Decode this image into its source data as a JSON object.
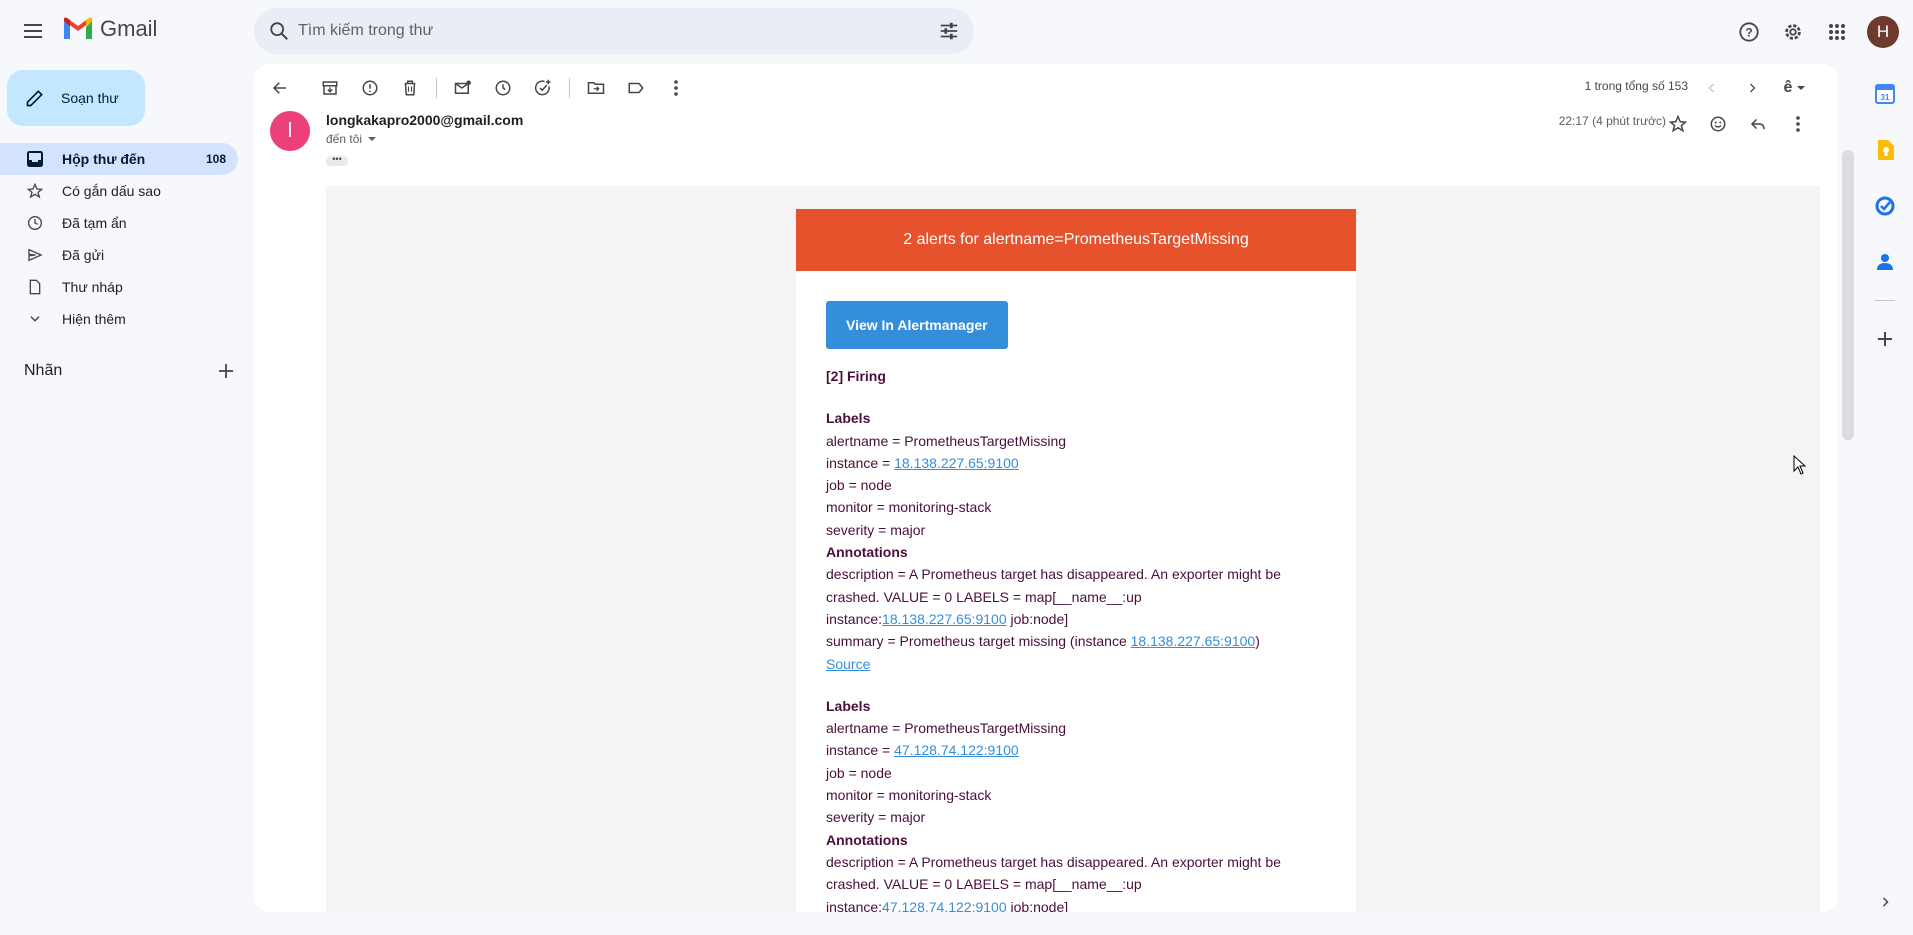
{
  "app": {
    "name": "Gmail"
  },
  "search": {
    "placeholder": "Tìm kiếm trong thư"
  },
  "account": {
    "initial": "H"
  },
  "compose": {
    "label": "Soạn thư"
  },
  "sidebar": {
    "items": [
      {
        "label": "Hộp thư đến",
        "count": "108",
        "icon": "inbox-icon",
        "active": true
      },
      {
        "label": "Có gắn dấu sao",
        "icon": "star-icon"
      },
      {
        "label": "Đã tạm ẩn",
        "icon": "clock-icon"
      },
      {
        "label": "Đã gửi",
        "icon": "send-icon"
      },
      {
        "label": "Thư nháp",
        "icon": "draft-icon"
      },
      {
        "label": "Hiện thêm",
        "icon": "chevron-down-icon"
      }
    ],
    "labels_title": "Nhãn"
  },
  "toolbar": {
    "pager_text": "1 trong tổng số 153",
    "input_tool": "ê"
  },
  "message": {
    "sender_initial": "l",
    "sender": "longkakapro2000@gmail.com",
    "to": "đến tôi",
    "time": "22:17 (4 phút trước)"
  },
  "email": {
    "header": "2 alerts for alertname=PrometheusTargetMissing",
    "button": "View In Alertmanager",
    "firing": "[2] Firing",
    "alerts": [
      {
        "labels_title": "Labels",
        "alertname": "alertname = PrometheusTargetMissing",
        "instance_prefix": "instance = ",
        "instance": "18.138.227.65:9100",
        "job": "job = node",
        "monitor": "monitor = monitoring-stack",
        "severity": "severity = major",
        "annotations_title": "Annotations",
        "desc_1": "description = A Prometheus target has disappeared. An exporter might be",
        "desc_2": "crashed. VALUE = 0 LABELS = map[__name__:up",
        "desc_3_prefix": "instance:",
        "desc_3_link": "18.138.227.65:9100",
        "desc_3_suffix": " job:node]",
        "summary_prefix": "summary = Prometheus target missing (instance ",
        "summary_link": "18.138.227.65:9100",
        "summary_suffix": ")",
        "source": "Source"
      },
      {
        "labels_title": "Labels",
        "alertname": "alertname = PrometheusTargetMissing",
        "instance_prefix": "instance = ",
        "instance": "47.128.74.122:9100",
        "job": "job = node",
        "monitor": "monitor = monitoring-stack",
        "severity": "severity = major",
        "annotations_title": "Annotations",
        "desc_1": "description = A Prometheus target has disappeared. An exporter might be",
        "desc_2": "crashed. VALUE = 0 LABELS = map[__name__:up",
        "desc_3_prefix": "instance:",
        "desc_3_link": "47.128.74.122:9100",
        "desc_3_suffix": " job:node]"
      }
    ]
  },
  "colors": {
    "alert_header": "#e6522c",
    "button": "#348eda",
    "text": "#4a0f3a",
    "nav_active": "#d3e3fd",
    "compose": "#c2e7ff"
  }
}
